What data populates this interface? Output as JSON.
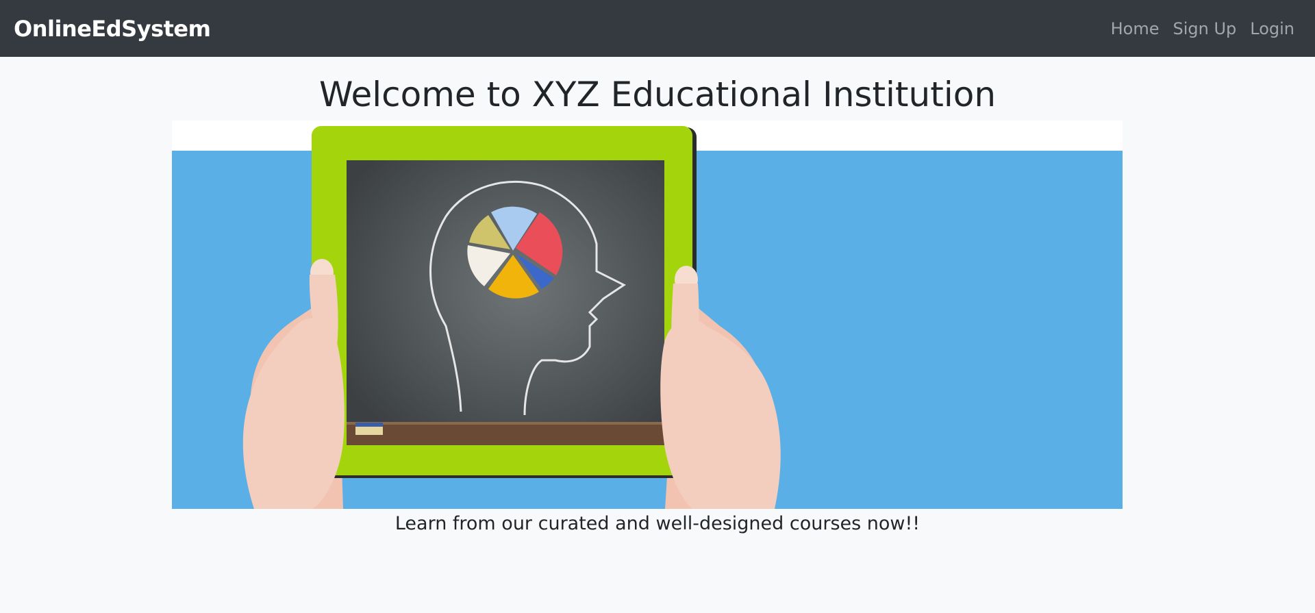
{
  "navbar": {
    "brand": "OnlineEdSystem",
    "links": [
      "Home",
      "Sign Up",
      "Login"
    ]
  },
  "main": {
    "title": "Welcome to XYZ Educational Institution",
    "tagline": "Learn from our curated and well-designed courses now!!",
    "hero_image": "hands-holding-tablet-with-chalkboard-head-pie-chart-illustration"
  },
  "colors": {
    "navbar_bg": "#343a40",
    "page_bg": "#f8f9fa",
    "hero_blue": "#5aafe6",
    "tablet_green": "#a2d20c",
    "chalkboard": "#4a4e50"
  }
}
